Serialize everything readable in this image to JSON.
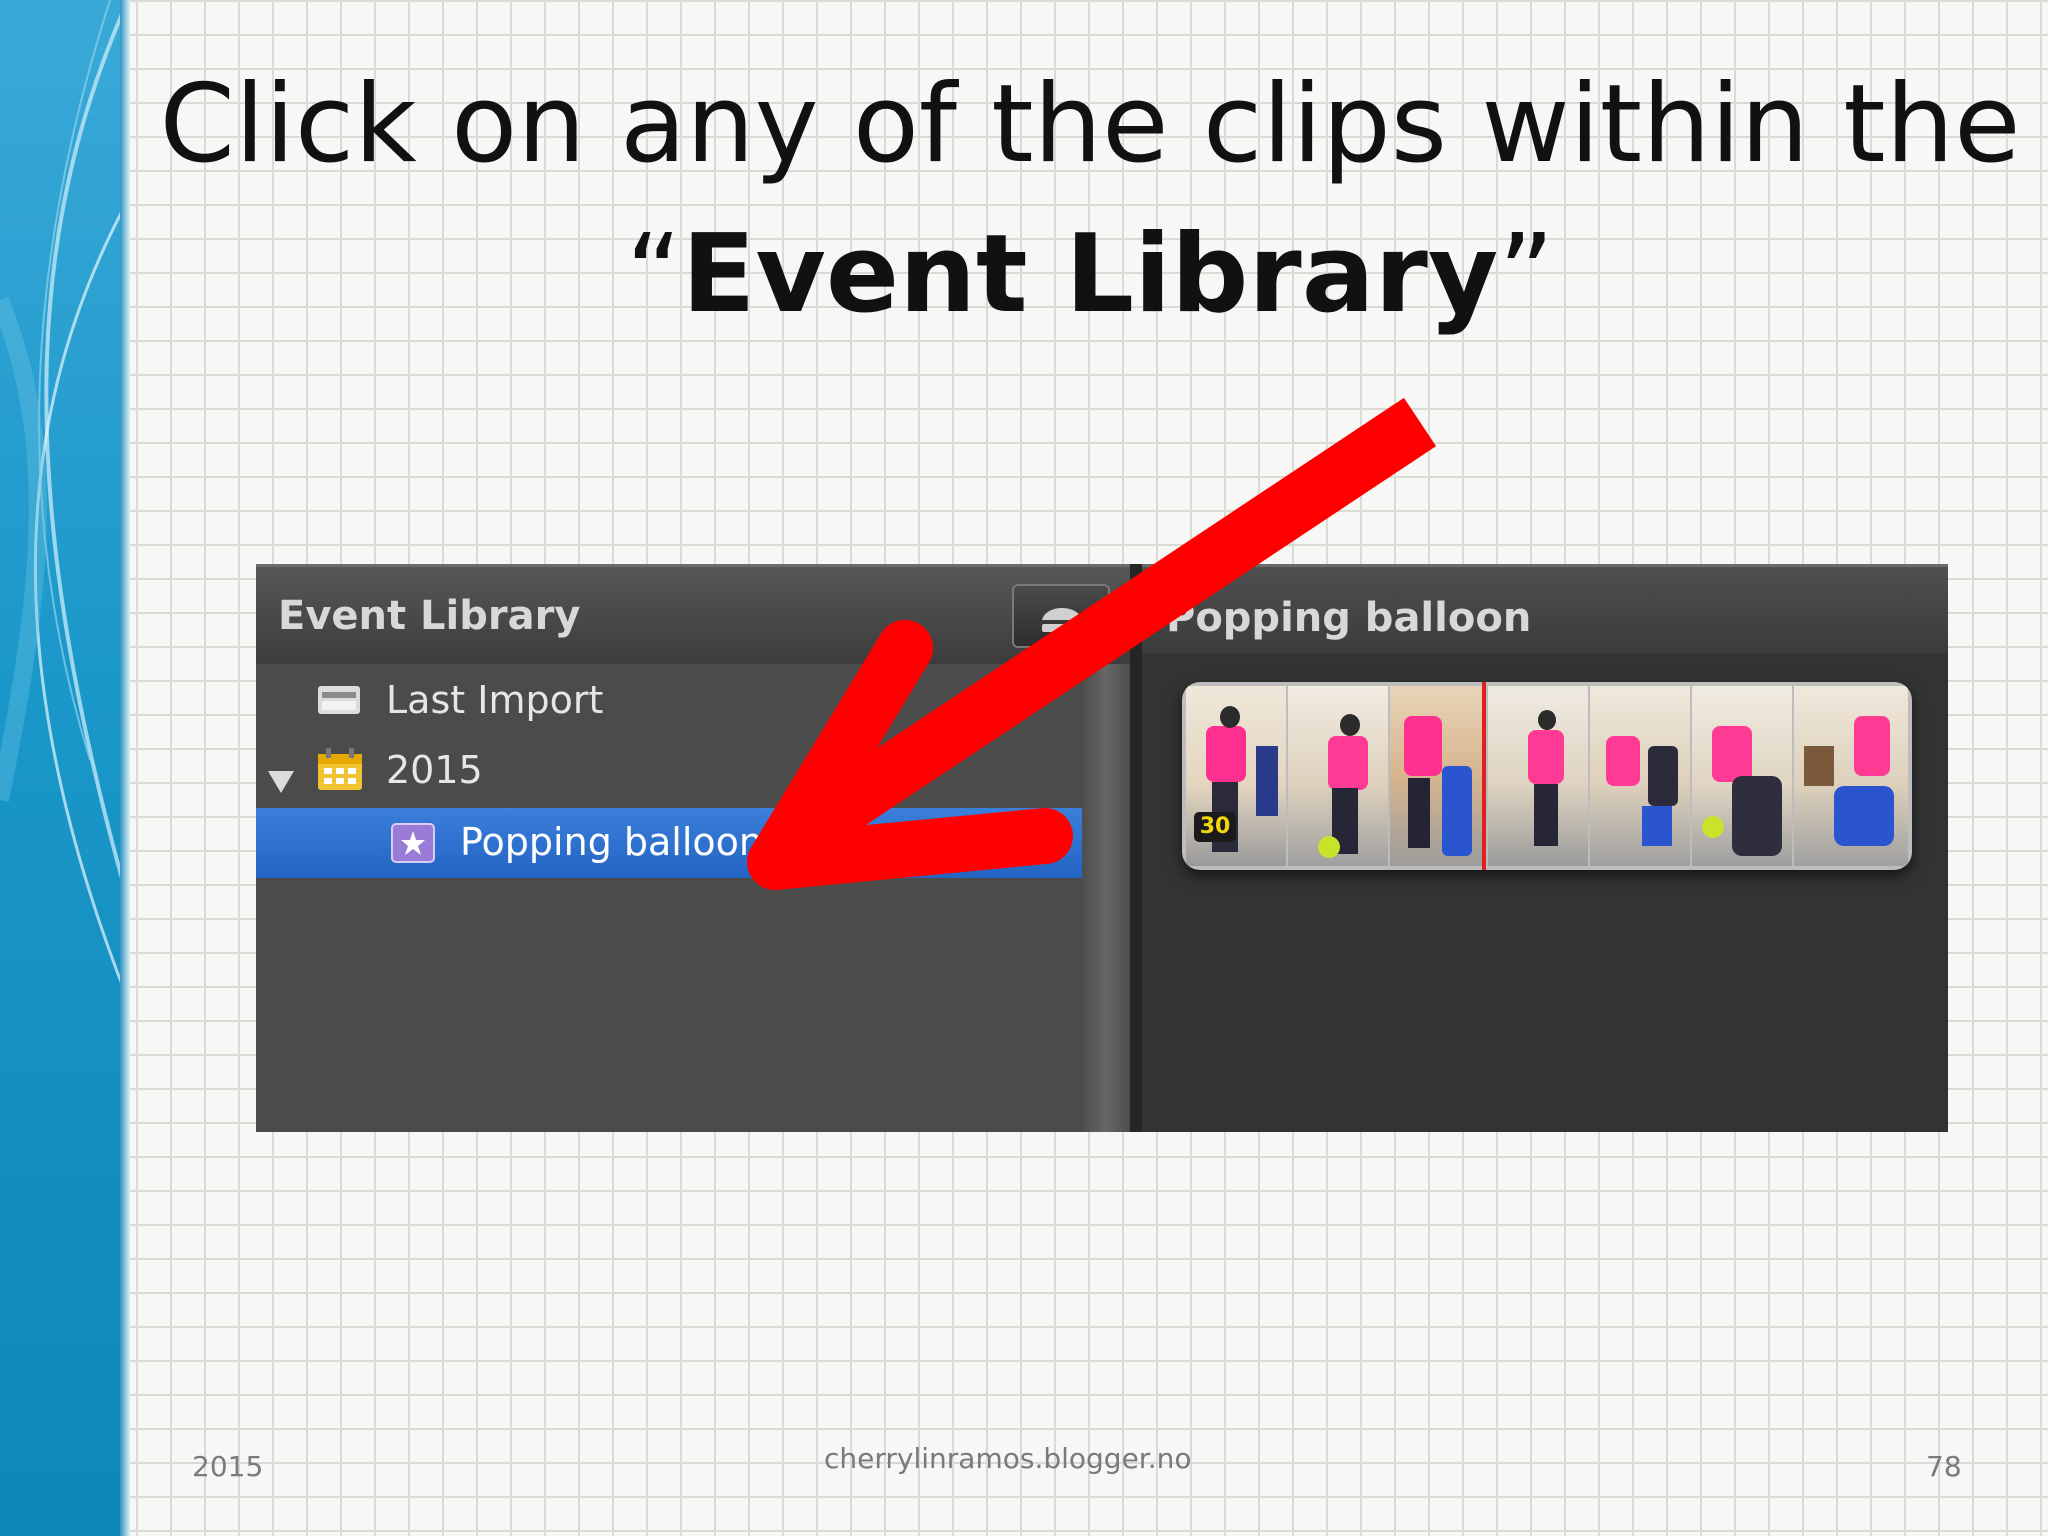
{
  "slide": {
    "title_line1": "Click on any of the clips within the",
    "title_line2_open_quote": "“",
    "title_line2_bold": "Event Library",
    "title_line2_close_quote": "”",
    "footer_left": "2015",
    "footer_center": "cherrylinramos.blogger.no",
    "footer_right": "78"
  },
  "event_library": {
    "title": "Event Library",
    "eject_icon": "eject-icon",
    "items": [
      {
        "label": "Last Import",
        "icon": "last-import-icon",
        "expanded": false,
        "selected": false
      },
      {
        "label": "2015",
        "icon": "calendar-icon",
        "expanded": true,
        "selected": false
      },
      {
        "label": "Popping balloon",
        "icon": "star-event-icon",
        "expanded": false,
        "selected": true
      }
    ]
  },
  "event_browser": {
    "title": "Popping balloon",
    "clip_duration_badge": "30"
  },
  "annotation": {
    "arrow_color": "#ff0000",
    "arrow_icon": "red-arrow"
  },
  "colors": {
    "selection": "#2f6fd0",
    "accent_band": "#1a97c9",
    "playhead": "#e02020"
  }
}
